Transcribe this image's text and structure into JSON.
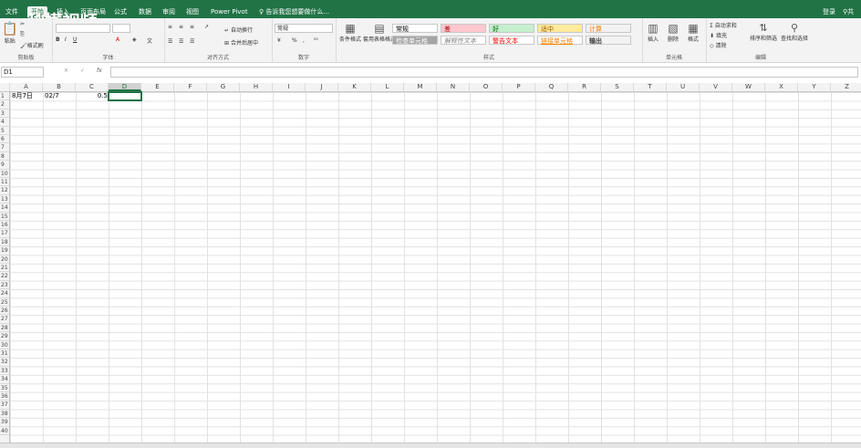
{
  "tabs": [
    "文件",
    "开始",
    "插入",
    "页面布局",
    "公式",
    "数据",
    "审阅",
    "视图",
    "Power Pivot"
  ],
  "tellme": "告诉我您想要做什么...",
  "account": {
    "login": "登录",
    "share": "共享"
  },
  "ribbon": {
    "clipboard": {
      "label": "剪贴板",
      "paste": "粘贴",
      "cut": "剪切",
      "copy": "复制",
      "format_painter": "格式刷"
    },
    "font": {
      "label": "字体",
      "bold": "B",
      "italic": "I",
      "underline": "U"
    },
    "alignment": {
      "label": "对齐方式",
      "wrap": "自动换行",
      "merge": "合并后居中"
    },
    "number": {
      "label": "数字",
      "format": "常规",
      "percent": "%"
    },
    "styles": {
      "label": "样式",
      "conditional": "条件格式",
      "table_fmt": "套用表格格式",
      "cells": [
        {
          "text": "常规",
          "bg": "#ffffff",
          "fg": "#000000"
        },
        {
          "text": "差",
          "bg": "#ffc7ce",
          "fg": "#9c0006"
        },
        {
          "text": "好",
          "bg": "#c6efce",
          "fg": "#006100"
        },
        {
          "text": "适中",
          "bg": "#ffeb9c",
          "fg": "#9c5700"
        },
        {
          "text": "计算",
          "bg": "#f2f2f2",
          "fg": "#fa7d00"
        },
        {
          "text": "检查单元格",
          "bg": "#a5a5a5",
          "fg": "#ffffff"
        },
        {
          "text": "解释性文本",
          "bg": "#ffffff",
          "fg": "#7f7f7f"
        },
        {
          "text": "警告文本",
          "bg": "#ffffff",
          "fg": "#ff0000"
        },
        {
          "text": "链接单元格",
          "bg": "#ffffff",
          "fg": "#fa7d00"
        },
        {
          "text": "输出",
          "bg": "#f2f2f2",
          "fg": "#3f3f3f"
        }
      ]
    },
    "cells": {
      "label": "单元格",
      "insert": "插入",
      "delete": "删除",
      "format": "格式"
    },
    "editing": {
      "label": "编辑",
      "autosum": "自动求和",
      "fill": "填充",
      "clear": "清除",
      "sort": "排序和筛选",
      "find": "查找和选择"
    }
  },
  "namebox": "D1",
  "columns": [
    "A",
    "B",
    "C",
    "D",
    "E",
    "F",
    "G",
    "H",
    "I",
    "J",
    "K",
    "L",
    "M",
    "N",
    "O",
    "P",
    "Q",
    "R",
    "S",
    "T",
    "U",
    "V",
    "W",
    "X",
    "Y",
    "Z"
  ],
  "rows": [
    "1",
    "2",
    "3",
    "4",
    "5",
    "6",
    "7",
    "8",
    "9",
    "10",
    "11",
    "12",
    "13",
    "14",
    "15",
    "16",
    "17",
    "18",
    "19",
    "20",
    "21",
    "22",
    "23",
    "24",
    "25",
    "26",
    "27",
    "28",
    "29",
    "30",
    "31",
    "32",
    "33",
    "34",
    "35",
    "36",
    "37",
    "38",
    "39",
    "40"
  ],
  "cell_values": {
    "A1": "8月7日",
    "B1": "02/7",
    "C1": "0.5"
  },
  "watermark": "秒懂视频"
}
